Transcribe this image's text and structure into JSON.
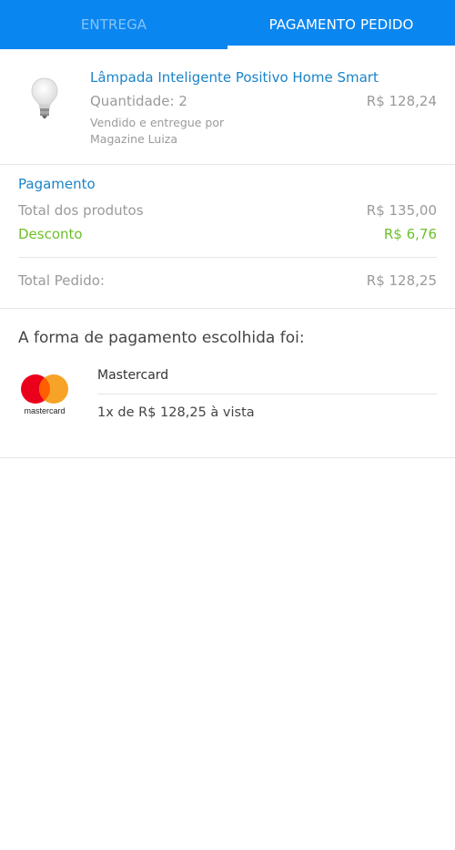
{
  "tabs": {
    "delivery": "ENTREGA",
    "payment": "PAGAMENTO PEDIDO"
  },
  "product": {
    "name": "Lâmpada Inteligente Positivo Home Smart",
    "quantity": "Quantidade: 2",
    "price": "R$ 128,24",
    "seller_line1": "Vendido e entregue por",
    "seller_line2": "Magazine Luiza",
    "image_icon": "light-bulb"
  },
  "payment": {
    "title": "Pagamento",
    "products_total_label": "Total dos produtos",
    "products_total_value": "R$ 135,00",
    "discount_label": "Desconto",
    "discount_value": "R$ 6,76",
    "order_total_label": "Total Pedido:",
    "order_total_value": "R$ 128,25"
  },
  "method": {
    "title": "A forma de pagamento escolhida foi:",
    "brand": "Mastercard",
    "logo_text": "mastercard",
    "installment": "1x de R$ 128,25 à vista"
  },
  "colors": {
    "header": "#0a86f0",
    "link_blue": "#1a84c8",
    "discount_green": "#6cbf2a",
    "mc_red": "#eb001b",
    "mc_orange": "#f79e1b"
  }
}
